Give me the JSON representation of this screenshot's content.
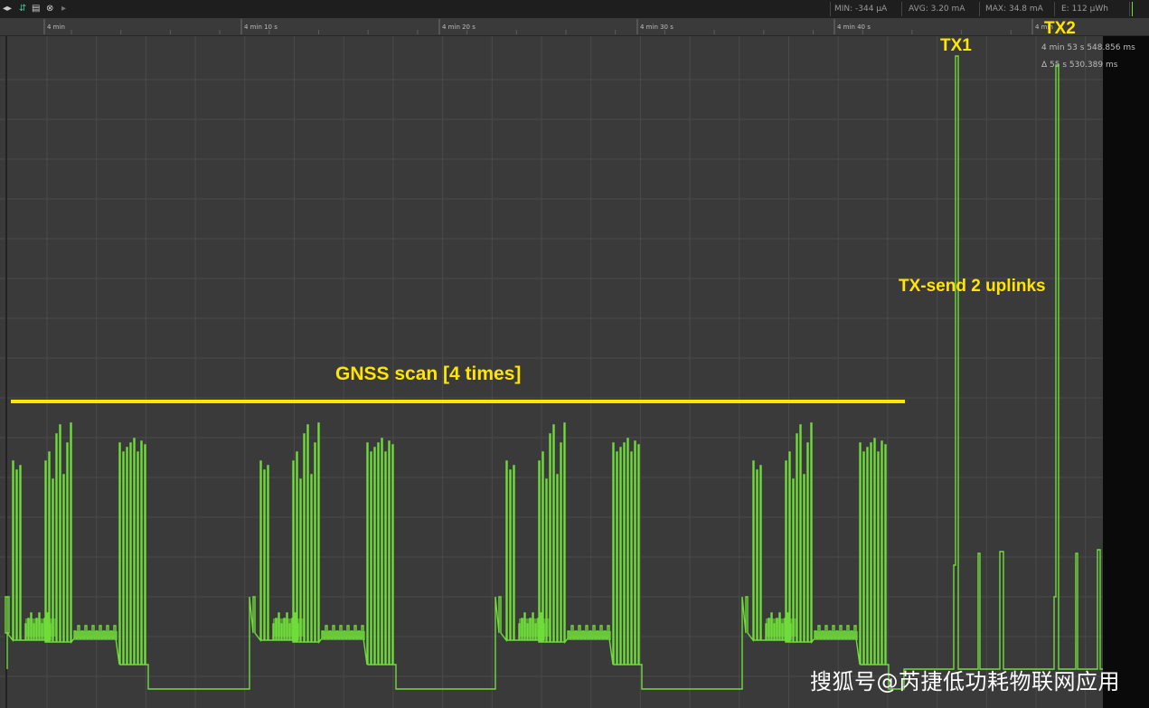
{
  "toolbar": {
    "icons": [
      "play-pause-icon",
      "sort-icon",
      "save-icon",
      "close-circle-icon",
      "forward-icon"
    ],
    "glyphs": [
      "◂▸",
      "⇵",
      "▤",
      "⊗",
      "▸"
    ],
    "stats": {
      "min": "MIN: -344 µA",
      "avg": "AVG: 3.20 mA",
      "max": "MAX: 34.8 mA",
      "energy": "E: 112 µWh"
    }
  },
  "ruler": {
    "ticks": [
      "4 min",
      "4 min 10 s",
      "4 min 20 s",
      "4 min 30 s",
      "4 min 40 s",
      "4 min"
    ]
  },
  "cursor": {
    "time": "4 min 53 s 548.856 ms",
    "delta": "Δ 55 s 530.389 ms"
  },
  "annotations": {
    "tx1": "TX1",
    "tx2": "TX2",
    "tx_send": "TX-send 2 uplinks",
    "gnss": "GNSS scan [4 times]"
  },
  "watermark": "搜狐号@芮捷低功耗物联网应用",
  "colors": {
    "background": "#2b2b2b",
    "plot_bg": "#3a3a3a",
    "grid": "#4a4a4a",
    "trace": "#6fdc3a",
    "annotation": "#ffe500",
    "right_panel": "#0a0a0a"
  },
  "chart_data": {
    "type": "line",
    "title": "",
    "xlabel": "",
    "ylabel": "",
    "x_axis_ticks": [
      "4 min",
      "4 min 10 s",
      "4 min 20 s",
      "4 min 30 s",
      "4 min 40 s",
      "4 min"
    ],
    "grid": true,
    "series": [
      {
        "description": "current trace: four GNSS scan bursts followed by two TX spikes"
      }
    ],
    "events": [
      {
        "label": "GNSS scan [4 times]",
        "count": 4
      },
      {
        "label": "TX1"
      },
      {
        "label": "TX2"
      },
      {
        "label": "TX-send 2 uplinks"
      }
    ]
  }
}
